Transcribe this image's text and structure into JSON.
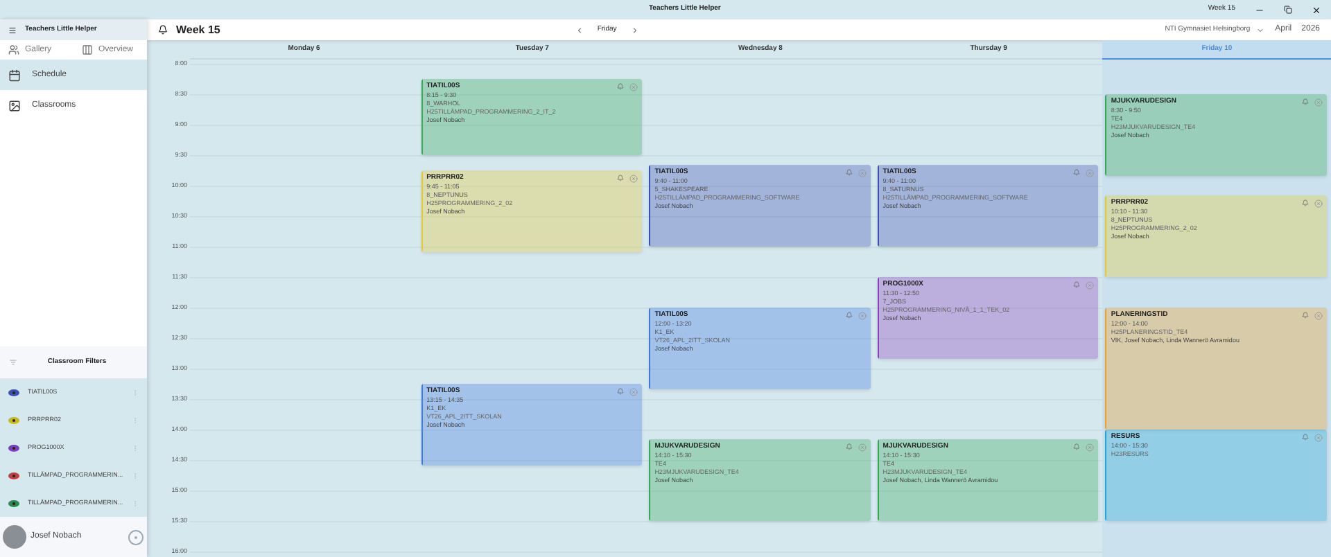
{
  "title_bar": {
    "title": "Teachers Little Helper",
    "week": "Week 15"
  },
  "sidebar": {
    "app_name": "Teachers Little Helper",
    "tabs": [
      {
        "label": "Gallery",
        "kind": "gallery",
        "selected": false
      },
      {
        "label": "Overview",
        "kind": "overview",
        "selected": false
      }
    ],
    "nav": [
      {
        "label": "Schedule",
        "kind": "schedule",
        "selected": true
      },
      {
        "label": "Classrooms",
        "kind": "classrooms",
        "selected": false
      }
    ],
    "filters_title": "Classroom Filters",
    "filters": [
      {
        "label": "TIATIL00S",
        "color": "#3b4fb0"
      },
      {
        "label": "PRRPRR02",
        "color": "#c8b820"
      },
      {
        "label": "PROG1000X",
        "color": "#7a3fb8"
      },
      {
        "label": "TILLÄMPAD_PROGRAMMERIN...",
        "color": "#c04040"
      },
      {
        "label": "TILLÄMPAD_PROGRAMMERIN...",
        "color": "#2a8a50"
      }
    ],
    "user": {
      "name": "Josef Nobach"
    }
  },
  "header": {
    "title": "Week 15",
    "day": "Friday",
    "school": "NTI Gymnasiet Helsingborg",
    "month": "April",
    "year": "2026"
  },
  "times": [
    "8:00",
    "8:30",
    "9:00",
    "9:30",
    "10:00",
    "10:30",
    "11:00",
    "11:30",
    "12:00",
    "12:30",
    "13:00",
    "13:30",
    "14:00",
    "14:30",
    "15:00",
    "15:30",
    "16:00"
  ],
  "days": [
    {
      "label": "Monday 6",
      "selected": false
    },
    {
      "label": "Tuesday 7",
      "selected": false,
      "events": [
        {
          "title": "TIATIL00S",
          "time": "8:15 - 9:30",
          "room": "8_WARHOL",
          "group": "H25TILLÄMPAD_PROGRAMMERING_2_IT_2",
          "teachers": "Josef Nobach",
          "color": "#34a853"
        },
        {
          "title": "PRRPRR02",
          "time": "9:45 - 11:05",
          "room": "8_NEPTUNUS",
          "group": "H25PROGRAMMERING_2_02",
          "teachers": "Josef Nobach",
          "color": "#e8c830"
        },
        {
          "title": "TIATIL00S",
          "time": "13:15 - 14:35",
          "room": "K1_EK",
          "group": "VT26_APL_2ITT_SKOLAN",
          "teachers": "Josef Nobach",
          "color": "#3b78e0"
        }
      ]
    },
    {
      "label": "Wednesday 8",
      "selected": false,
      "events": [
        {
          "title": "TIATIL00S",
          "time": "9:40 - 11:00",
          "room": "5_SHAKESPEARE",
          "group": "H25TILLÄMPAD_PROGRAMMERING_SOFTWARE",
          "teachers": "Josef Nobach",
          "color": "#3b4fb0"
        },
        {
          "title": "TIATIL00S",
          "time": "12:00 - 13:20",
          "room": "K1_EK",
          "group": "VT26_APL_2ITT_SKOLAN",
          "teachers": "Josef Nobach",
          "color": "#3b78e0"
        },
        {
          "title": "MJUKVARUDESIGN",
          "time": "14:10 - 15:30",
          "room": "TE4",
          "group": "H23MJUKVARUDESIGN_TE4",
          "teachers": "Josef Nobach",
          "color": "#34a853"
        }
      ]
    },
    {
      "label": "Thursday 9",
      "selected": false,
      "events": [
        {
          "title": "TIATIL00S",
          "time": "9:40 - 11:00",
          "room": "8_SATURNUS",
          "group": "H25TILLÄMPAD_PROGRAMMERING_SOFTWARE",
          "teachers": "Josef Nobach",
          "color": "#3b4fb0"
        },
        {
          "title": "PROG1000X",
          "time": "11:30 - 12:50",
          "room": "7_JOBS",
          "group": "H25PROGRAMMERING_NIVÅ_1_1_TEK_02",
          "teachers": "Josef Nobach",
          "color": "#8a3fc0"
        },
        {
          "title": "MJUKVARUDESIGN",
          "time": "14:10 - 15:30",
          "room": "TE4",
          "group": "H23MJUKVARUDESIGN_TE4",
          "teachers": "Josef Nobach, Linda Wannerö Avramidou",
          "color": "#34a853"
        }
      ]
    },
    {
      "label": "Friday 10",
      "selected": true,
      "events": [
        {
          "title": "MJUKVARUDESIGN",
          "time": "8:30 - 9:50",
          "room": "TE4",
          "group": "H23MJUKVARUDESIGN_TE4",
          "teachers": "Josef Nobach",
          "color": "#34a853"
        },
        {
          "title": "PRRPRR02",
          "time": "10:10 - 11:30",
          "room": "8_NEPTUNUS",
          "group": "H25PROGRAMMERING_2_02",
          "teachers": "Josef Nobach",
          "color": "#e8c830"
        },
        {
          "title": "PLANERINGSTID",
          "time": "12:00 - 14:00",
          "group": "H25PLANERINGSTID_TE4",
          "teachers": "VIK, Josef Nobach, Linda Wannerö Avramidou",
          "color": "#f0a020"
        },
        {
          "title": "RESURS",
          "time": "14:00 - 15:30",
          "group": "H23RESURS",
          "color": "#20a8d8"
        }
      ]
    }
  ]
}
